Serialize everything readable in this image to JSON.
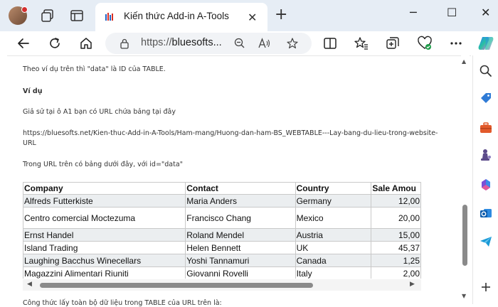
{
  "browser": {
    "tab_title": "Kiến thức Add-in A-Tools",
    "tab_close": "✕",
    "new_tab": "+",
    "url_prefix": "https://",
    "url_host": "bluesofts...",
    "window_minimize": "─",
    "window_maximize": "☐",
    "window_close": "✕",
    "accent_color": "#0067c0"
  },
  "page": {
    "p1": "Theo ví dụ trên thì \"data\" là ID của TABLE.",
    "p2": "Ví dụ",
    "p3": "Giả sử tại ô A1 bạn có URL chứa bảng tại đây",
    "p4a": "https://bluesofts.net/Kien-thuc-Add-in-A-Tools/Ham-mang/Huong-dan-ham-BS_WEBTABLE---Lay-bang-du-lieu-trong-website-",
    "p4b": "URL",
    "p5": "Trong URL trên có bảng dưới đây, với id=\"data\"",
    "p6": "Công thức lấy toàn bộ dữ liệu trong TABLE của URL trên là:"
  },
  "table": {
    "headers": [
      "Company",
      "Contact",
      "Country",
      "Sale Amou"
    ],
    "rows": [
      [
        "Alfreds Futterkiste",
        "Maria Anders",
        "Germany",
        "12,00"
      ],
      [
        "Centro comercial Moctezuma",
        "Francisco Chang",
        "Mexico",
        "20,00"
      ],
      [
        "Ernst Handel",
        "Roland Mendel",
        "Austria",
        "15,00"
      ],
      [
        "Island Trading",
        "Helen Bennett",
        "UK",
        "45,37"
      ],
      [
        "Laughing Bacchus Winecellars",
        "Yoshi Tannamuri",
        "Canada",
        "1,25"
      ],
      [
        "Magazzini Alimentari Riuniti",
        "Giovanni Rovelli",
        "Italy",
        "2,00"
      ]
    ]
  }
}
